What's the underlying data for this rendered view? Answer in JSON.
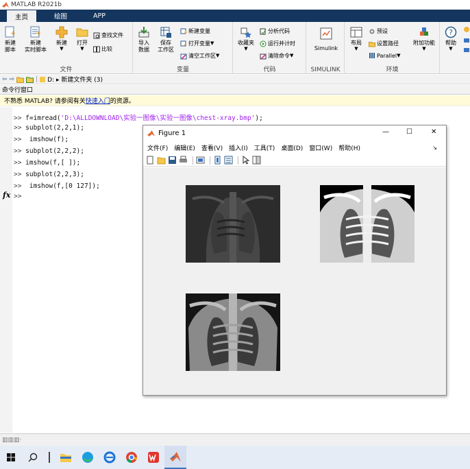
{
  "app": {
    "title": "MATLAB R2021b"
  },
  "tabs": [
    {
      "label": "主页",
      "active": true
    },
    {
      "label": "绘图"
    },
    {
      "label": "APP"
    }
  ],
  "ribbon": {
    "file": {
      "label": "文件",
      "new_script": "新建\n脚本",
      "new_live": "新建\n实时脚本",
      "new": "新建",
      "open": "打开",
      "find_files": "查找文件",
      "compare": "比较"
    },
    "variable": {
      "label": "变量",
      "import": "导入\n数据",
      "save": "保存\n工作区",
      "new_var": "新建变量",
      "open_var": "打开变量",
      "clear_ws": "清空工作区"
    },
    "code": {
      "label": "代码",
      "favorites": "收藏夹",
      "analyze": "分析代码",
      "run_time": "运行并计时",
      "clear_cmd": "清除命令"
    },
    "simulink": {
      "label": "SIMULINK",
      "simulink": "Simulink"
    },
    "env": {
      "label": "环境",
      "layout": "布局",
      "prefs": "预设",
      "set_path": "设置路径",
      "parallel": "Parallel",
      "addons": "附加功能"
    },
    "help": {
      "help": "帮助"
    }
  },
  "address": {
    "path": "D: ▸ 新建文件夹 (3)"
  },
  "command_window": {
    "header": "命令行窗口",
    "notice_pre": "不熟悉 MATLAB? 请参阅有关",
    "notice_link": "快速入门",
    "notice_post": "的资源。",
    "prompt": ">>",
    "lines": [
      {
        "code": " f=imread(",
        "str": "'D:\\ALLDOWNLOAD\\实验一图像\\实验一图像\\chest-xray.bmp'",
        "tail": ");"
      },
      {
        "code": " subplot(2,2,1);"
      },
      {
        "code": "  imshow(f);"
      },
      {
        "code": " subplot(2,2,2);"
      },
      {
        "code": " imshow(f,[ ]);"
      },
      {
        "code": " subplot(2,2,3);"
      },
      {
        "code": "  imshow(f,[0 127]);"
      }
    ],
    "fx": "fx"
  },
  "figure": {
    "title": "Figure 1",
    "menus": [
      "文件(F)",
      "编辑(E)",
      "查看(V)",
      "插入(I)",
      "工具(T)",
      "桌面(D)",
      "窗口(W)",
      "帮助(H)"
    ],
    "panels": [
      {
        "name": "imshow(f)",
        "contrast": "low"
      },
      {
        "name": "imshow(f,[ ])",
        "contrast": "high"
      },
      {
        "name": "imshow(f,[0 127])",
        "contrast": "mid"
      }
    ]
  },
  "colors": {
    "tabbar": "#14355e",
    "ribbon": "#f3f3f3",
    "notice": "#fffad7",
    "string": "#a020f0"
  }
}
